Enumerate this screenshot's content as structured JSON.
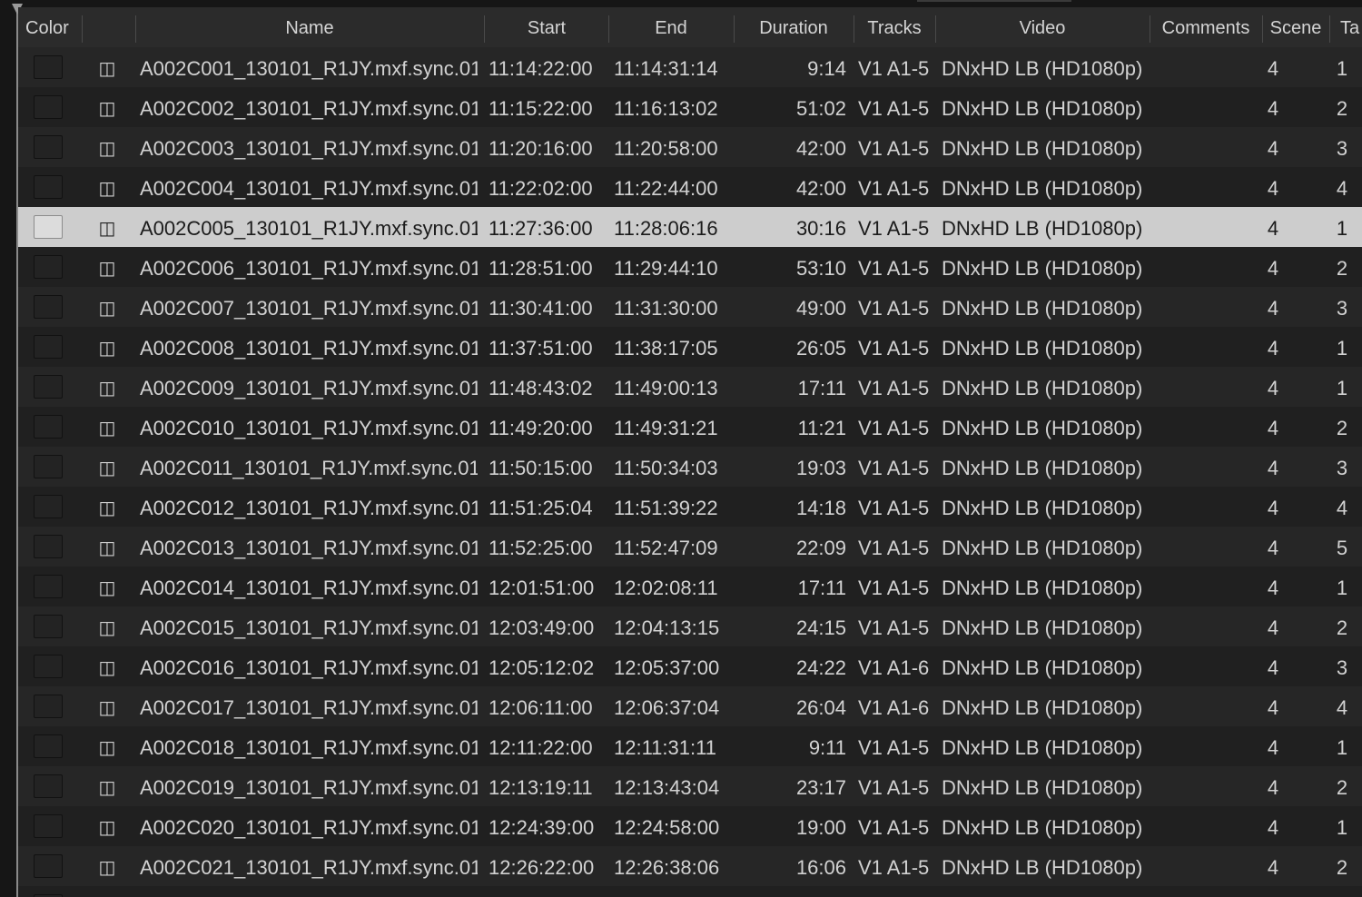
{
  "columns": [
    "Color",
    "",
    "Name",
    "Start",
    "End",
    "Duration",
    "Tracks",
    "Video",
    "Comments",
    "Scene",
    "Ta"
  ],
  "rows": [
    {
      "name": "A002C001_130101_R1JY.mxf.sync.01",
      "start": "11:14:22:00",
      "end": "11:14:31:14",
      "duration": "9:14",
      "tracks": "V1 A1-5",
      "video": "DNxHD LB (HD1080p)",
      "comments": "",
      "scene": "4",
      "take": "1"
    },
    {
      "name": "A002C002_130101_R1JY.mxf.sync.01",
      "start": "11:15:22:00",
      "end": "11:16:13:02",
      "duration": "51:02",
      "tracks": "V1 A1-5",
      "video": "DNxHD LB (HD1080p)",
      "comments": "",
      "scene": "4",
      "take": "2"
    },
    {
      "name": "A002C003_130101_R1JY.mxf.sync.01",
      "start": "11:20:16:00",
      "end": "11:20:58:00",
      "duration": "42:00",
      "tracks": "V1 A1-5",
      "video": "DNxHD LB (HD1080p)",
      "comments": "",
      "scene": "4",
      "take": "3"
    },
    {
      "name": "A002C004_130101_R1JY.mxf.sync.01",
      "start": "11:22:02:00",
      "end": "11:22:44:00",
      "duration": "42:00",
      "tracks": "V1 A1-5",
      "video": "DNxHD LB (HD1080p)",
      "comments": "",
      "scene": "4",
      "take": "4"
    },
    {
      "name": "A002C005_130101_R1JY.mxf.sync.01",
      "start": "11:27:36:00",
      "end": "11:28:06:16",
      "duration": "30:16",
      "tracks": "V1 A1-5",
      "video": "DNxHD LB (HD1080p)",
      "comments": "",
      "scene": "4",
      "take": "1",
      "selected": true
    },
    {
      "name": "A002C006_130101_R1JY.mxf.sync.01",
      "start": "11:28:51:00",
      "end": "11:29:44:10",
      "duration": "53:10",
      "tracks": "V1 A1-5",
      "video": "DNxHD LB (HD1080p)",
      "comments": "",
      "scene": "4",
      "take": "2"
    },
    {
      "name": "A002C007_130101_R1JY.mxf.sync.01",
      "start": "11:30:41:00",
      "end": "11:31:30:00",
      "duration": "49:00",
      "tracks": "V1 A1-5",
      "video": "DNxHD LB (HD1080p)",
      "comments": "",
      "scene": "4",
      "take": "3"
    },
    {
      "name": "A002C008_130101_R1JY.mxf.sync.01",
      "start": "11:37:51:00",
      "end": "11:38:17:05",
      "duration": "26:05",
      "tracks": "V1 A1-5",
      "video": "DNxHD LB (HD1080p)",
      "comments": "",
      "scene": "4",
      "take": "1"
    },
    {
      "name": "A002C009_130101_R1JY.mxf.sync.01",
      "start": "11:48:43:02",
      "end": "11:49:00:13",
      "duration": "17:11",
      "tracks": "V1 A1-5",
      "video": "DNxHD LB (HD1080p)",
      "comments": "",
      "scene": "4",
      "take": "1"
    },
    {
      "name": "A002C010_130101_R1JY.mxf.sync.01",
      "start": "11:49:20:00",
      "end": "11:49:31:21",
      "duration": "11:21",
      "tracks": "V1 A1-5",
      "video": "DNxHD LB (HD1080p)",
      "comments": "",
      "scene": "4",
      "take": "2"
    },
    {
      "name": "A002C011_130101_R1JY.mxf.sync.01",
      "start": "11:50:15:00",
      "end": "11:50:34:03",
      "duration": "19:03",
      "tracks": "V1 A1-5",
      "video": "DNxHD LB (HD1080p)",
      "comments": "",
      "scene": "4",
      "take": "3"
    },
    {
      "name": "A002C012_130101_R1JY.mxf.sync.01",
      "start": "11:51:25:04",
      "end": "11:51:39:22",
      "duration": "14:18",
      "tracks": "V1 A1-5",
      "video": "DNxHD LB (HD1080p)",
      "comments": "",
      "scene": "4",
      "take": "4"
    },
    {
      "name": "A002C013_130101_R1JY.mxf.sync.01",
      "start": "11:52:25:00",
      "end": "11:52:47:09",
      "duration": "22:09",
      "tracks": "V1 A1-5",
      "video": "DNxHD LB (HD1080p)",
      "comments": "",
      "scene": "4",
      "take": "5"
    },
    {
      "name": "A002C014_130101_R1JY.mxf.sync.01",
      "start": "12:01:51:00",
      "end": "12:02:08:11",
      "duration": "17:11",
      "tracks": "V1 A1-5",
      "video": "DNxHD LB (HD1080p)",
      "comments": "",
      "scene": "4",
      "take": "1"
    },
    {
      "name": "A002C015_130101_R1JY.mxf.sync.01",
      "start": "12:03:49:00",
      "end": "12:04:13:15",
      "duration": "24:15",
      "tracks": "V1 A1-5",
      "video": "DNxHD LB (HD1080p)",
      "comments": "",
      "scene": "4",
      "take": "2"
    },
    {
      "name": "A002C016_130101_R1JY.mxf.sync.01",
      "start": "12:05:12:02",
      "end": "12:05:37:00",
      "duration": "24:22",
      "tracks": "V1 A1-6",
      "video": "DNxHD LB (HD1080p)",
      "comments": "",
      "scene": "4",
      "take": "3"
    },
    {
      "name": "A002C017_130101_R1JY.mxf.sync.01",
      "start": "12:06:11:00",
      "end": "12:06:37:04",
      "duration": "26:04",
      "tracks": "V1 A1-6",
      "video": "DNxHD LB (HD1080p)",
      "comments": "",
      "scene": "4",
      "take": "4"
    },
    {
      "name": "A002C018_130101_R1JY.mxf.sync.01",
      "start": "12:11:22:00",
      "end": "12:11:31:11",
      "duration": "9:11",
      "tracks": "V1 A1-5",
      "video": "DNxHD LB (HD1080p)",
      "comments": "",
      "scene": "4",
      "take": "1"
    },
    {
      "name": "A002C019_130101_R1JY.mxf.sync.01",
      "start": "12:13:19:11",
      "end": "12:13:43:04",
      "duration": "23:17",
      "tracks": "V1 A1-5",
      "video": "DNxHD LB (HD1080p)",
      "comments": "",
      "scene": "4",
      "take": "2"
    },
    {
      "name": "A002C020_130101_R1JY.mxf.sync.01",
      "start": "12:24:39:00",
      "end": "12:24:58:00",
      "duration": "19:00",
      "tracks": "V1 A1-5",
      "video": "DNxHD LB (HD1080p)",
      "comments": "",
      "scene": "4",
      "take": "1"
    },
    {
      "name": "A002C021_130101_R1JY.mxf.sync.01",
      "start": "12:26:22:00",
      "end": "12:26:38:06",
      "duration": "16:06",
      "tracks": "V1 A1-5",
      "video": "DNxHD LB (HD1080p)",
      "comments": "",
      "scene": "4",
      "take": "2"
    },
    {
      "name": "",
      "start": "",
      "end": "",
      "duration": "",
      "tracks": "",
      "video": "",
      "comments": "",
      "scene": "",
      "take": ""
    }
  ],
  "icons": {
    "row_clip": "clip-icon",
    "playhead": "playhead-marker"
  },
  "colors": {
    "background": "#1f1f1f",
    "header": "#2b2b2b",
    "row_odd": "#262626",
    "row_even": "#202020",
    "selected_row": "#cdcdcd",
    "text": "#d2d2d2"
  }
}
